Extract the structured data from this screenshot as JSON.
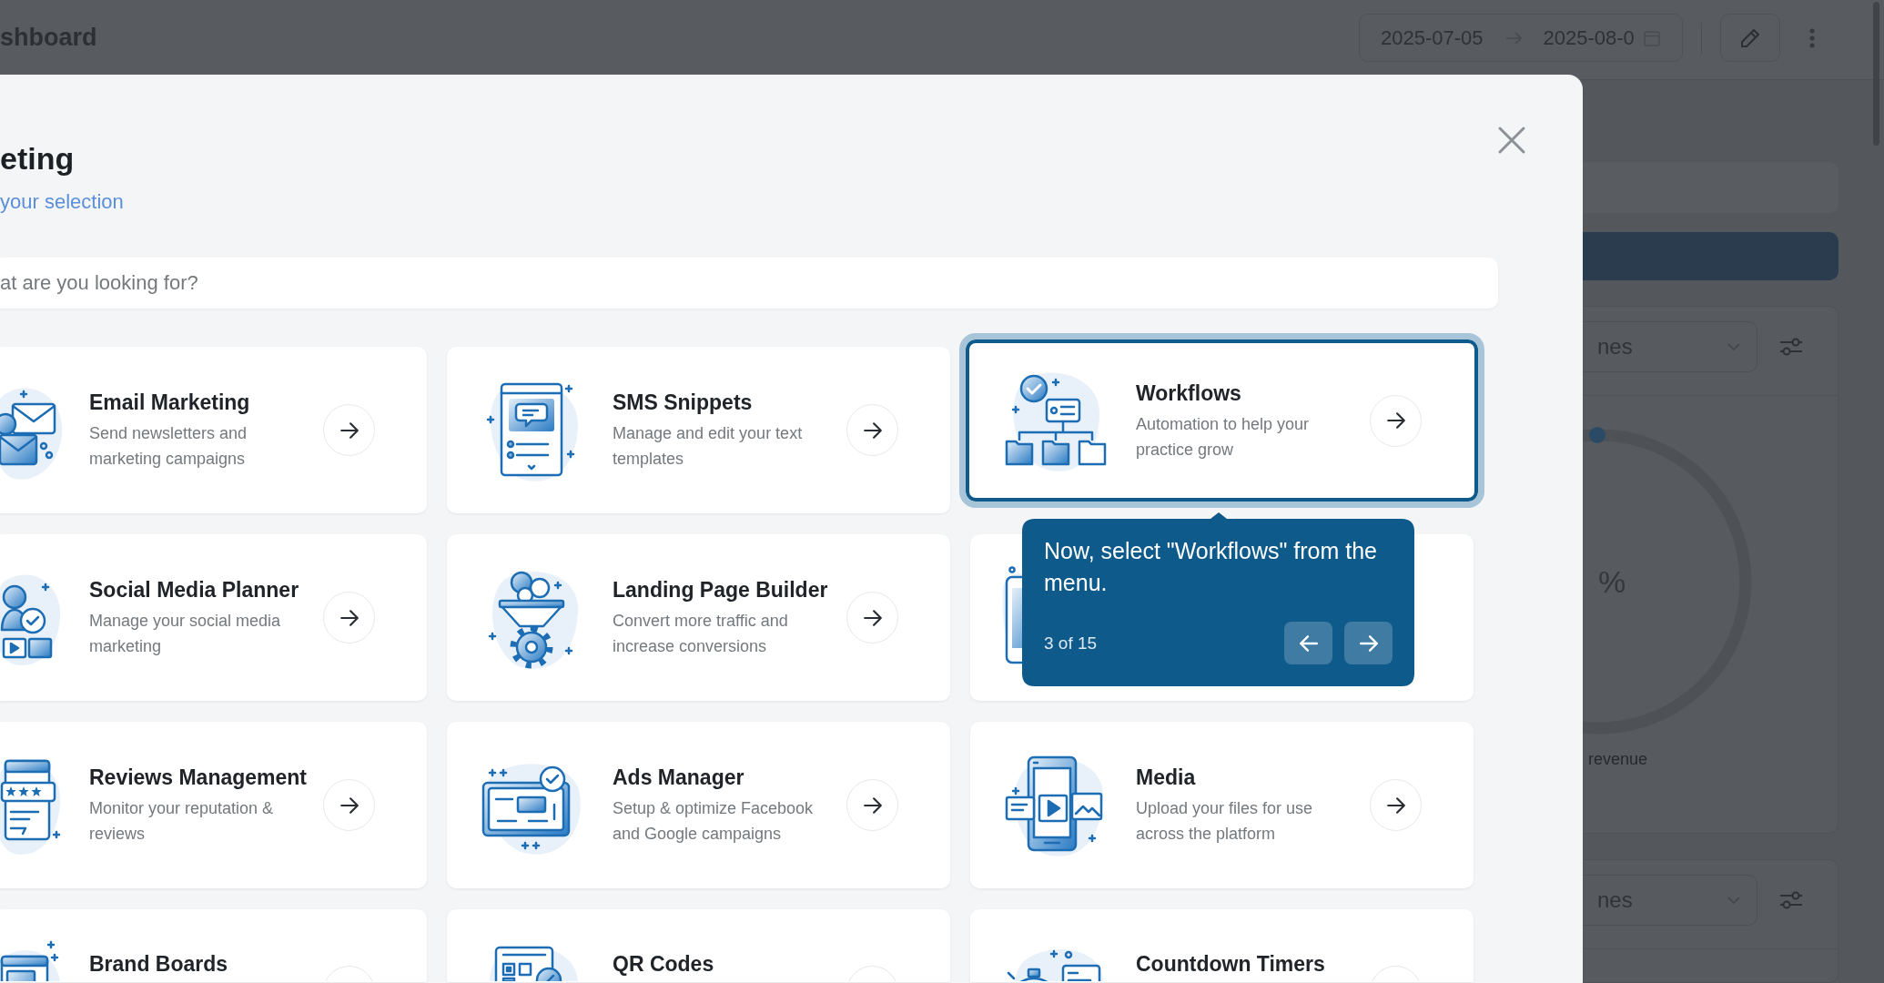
{
  "dashboard": {
    "title": "shboard",
    "date_range": {
      "start": "2025-07-05",
      "end": "2025-08-0"
    },
    "panels": [
      {
        "select": "nes",
        "gauge": {
          "value": "%",
          "caption": "revenue"
        }
      },
      {
        "select": "nes"
      }
    ]
  },
  "modal": {
    "title": "eting",
    "subtitle": "your selection",
    "search": {
      "placeholder": "at are you looking for?"
    },
    "cards": [
      {
        "kind": "app",
        "title": "Email Marketing",
        "description": "Send newsletters and marketing campaigns",
        "selected": false
      },
      {
        "kind": "app",
        "title": "SMS Snippets",
        "description": "Manage and edit your text templates",
        "selected": false
      },
      {
        "kind": "app",
        "title": "Workflows",
        "description": "Automation to help your practice grow",
        "selected": true
      },
      {
        "kind": "app",
        "title": "Social Media Planner",
        "description": "Manage your social media marketing",
        "selected": false
      },
      {
        "kind": "app",
        "title": "Landing Page Builder",
        "description": "Convert more traffic and increase conversions",
        "selected": false
      },
      {
        "kind": "covered",
        "selected": false
      },
      {
        "kind": "app",
        "title": "Reviews Management",
        "description": "Monitor your reputation & reviews",
        "selected": false
      },
      {
        "kind": "app",
        "title": "Ads Manager",
        "description": "Setup & optimize Facebook and Google campaigns",
        "selected": false
      },
      {
        "kind": "app",
        "title": "Media",
        "description": "Upload your files for use across the platform",
        "selected": false
      },
      {
        "kind": "app",
        "title": "Brand Boards",
        "selected": false
      },
      {
        "kind": "app",
        "title": "QR Codes",
        "selected": false
      },
      {
        "kind": "app",
        "title": "Countdown Timers",
        "selected": false
      }
    ]
  },
  "tour": {
    "message": "Now, select \"Workflows\" from the menu.",
    "step": "3 of 15"
  }
}
